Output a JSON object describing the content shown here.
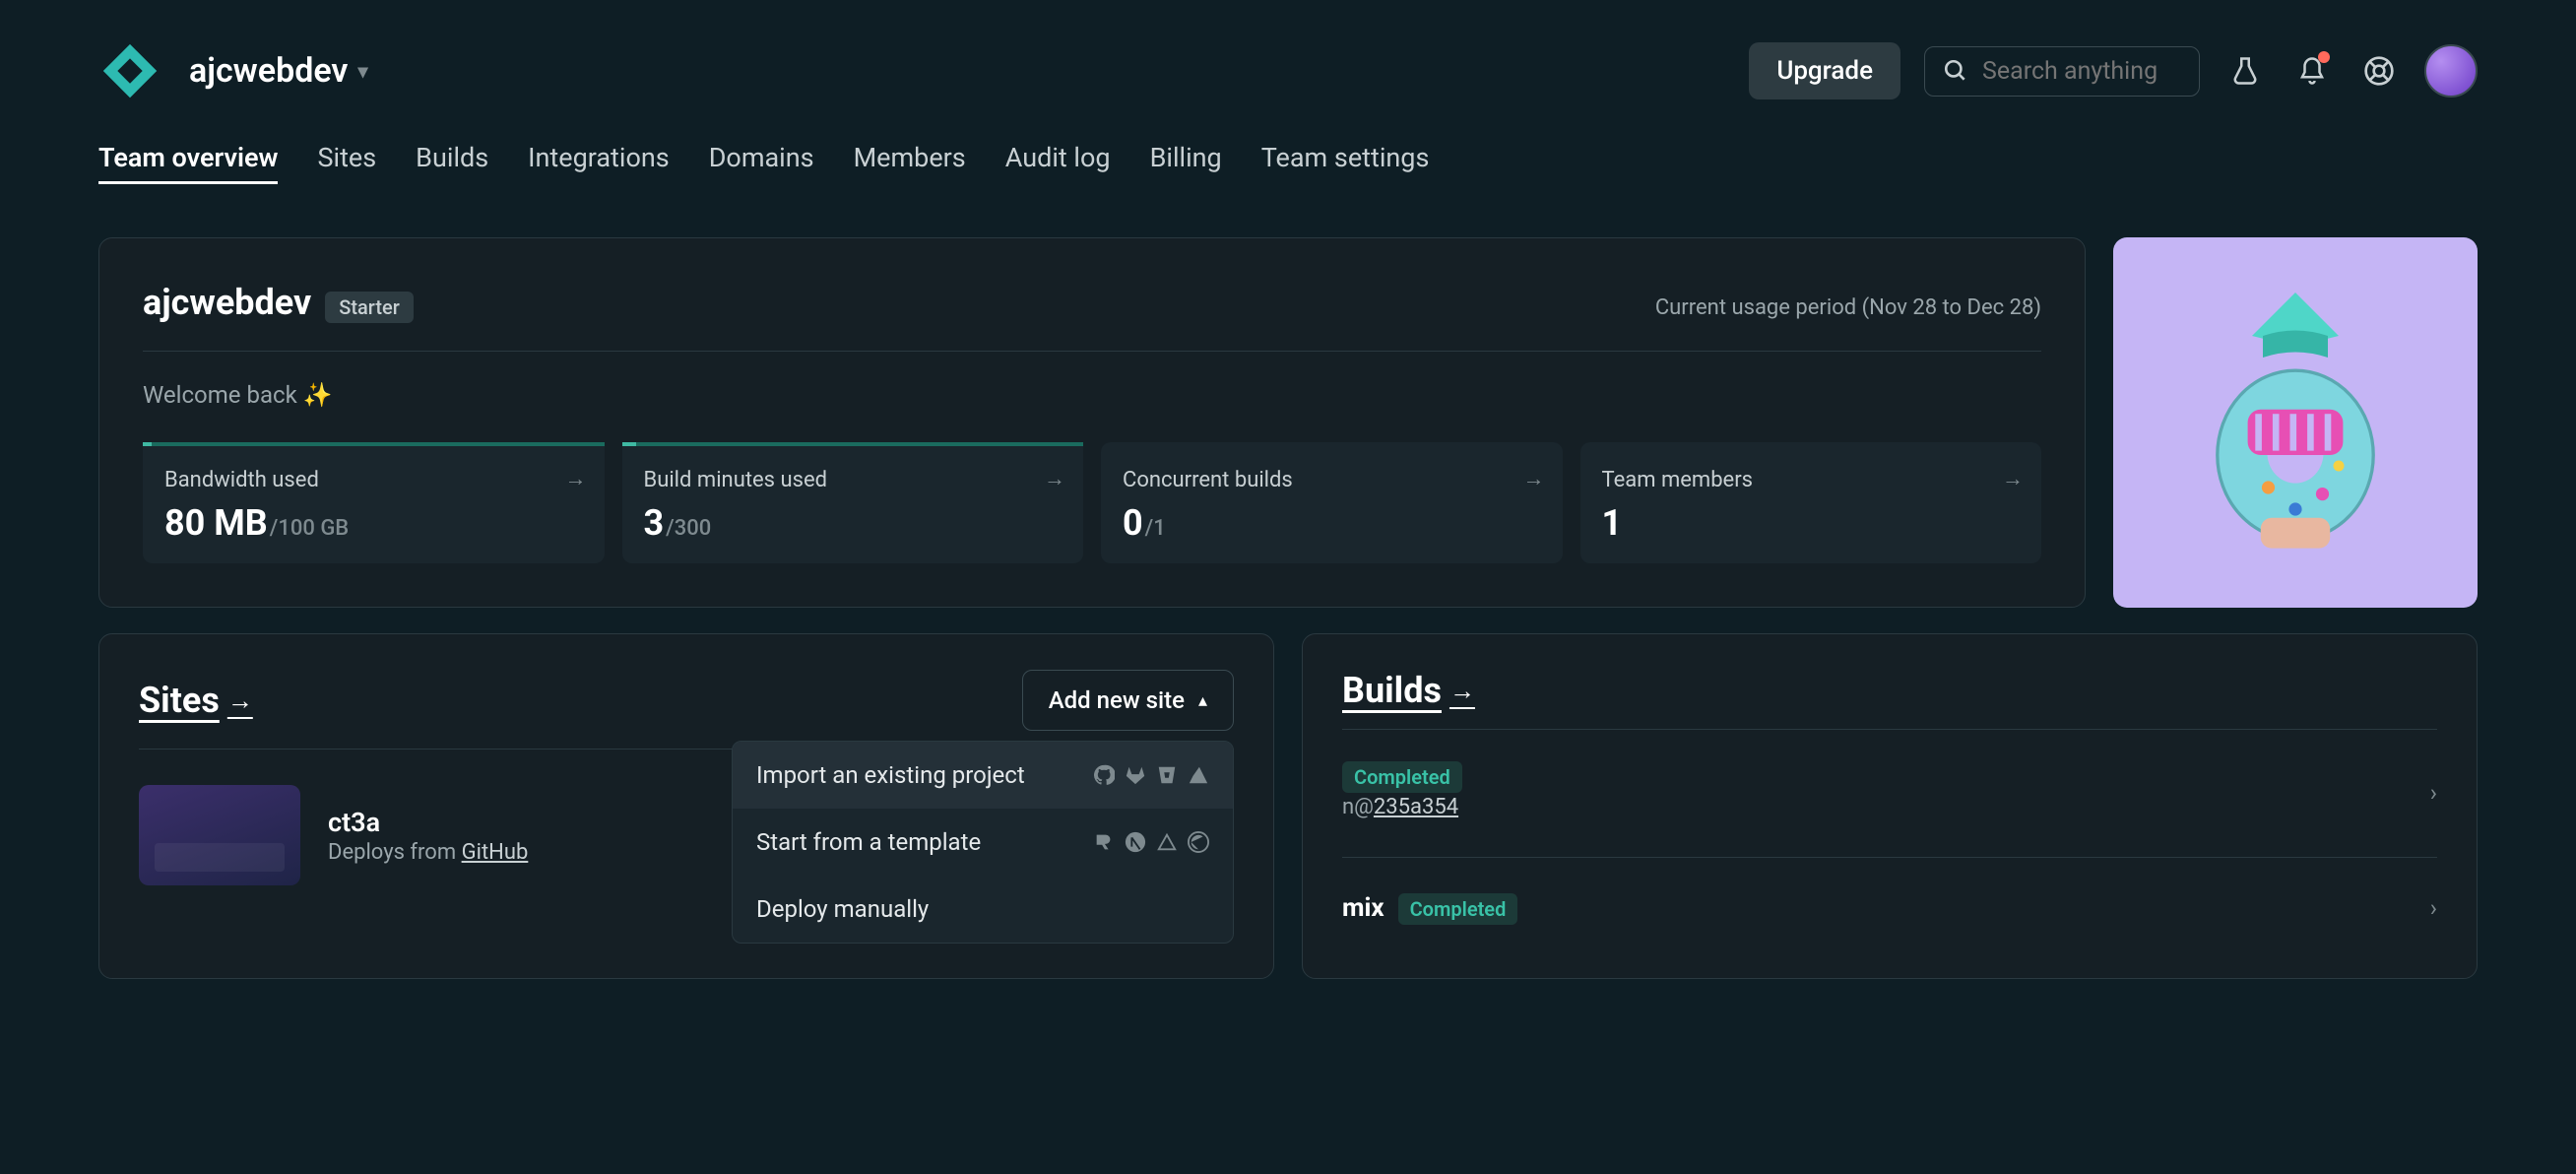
{
  "header": {
    "team_name": "ajcwebdev",
    "upgrade_label": "Upgrade",
    "search_placeholder": "Search anything"
  },
  "nav": {
    "tabs": [
      "Team overview",
      "Sites",
      "Builds",
      "Integrations",
      "Domains",
      "Members",
      "Audit log",
      "Billing",
      "Team settings"
    ],
    "active_index": 0
  },
  "overview": {
    "team_name": "ajcwebdev",
    "plan": "Starter",
    "usage_period": "Current usage period (Nov 28 to Dec 28)",
    "welcome": "Welcome back ✨",
    "stats": [
      {
        "label": "Bandwidth used",
        "value": "80 MB",
        "sub": "/100 GB"
      },
      {
        "label": "Build minutes used",
        "value": "3",
        "sub": "/300"
      },
      {
        "label": "Concurrent builds",
        "value": "0",
        "sub": "/1"
      },
      {
        "label": "Team members",
        "value": "1",
        "sub": ""
      }
    ]
  },
  "sites_panel": {
    "title": "Sites",
    "add_label": "Add new site",
    "dropdown": [
      "Import an existing project",
      "Start from a template",
      "Deploy manually"
    ],
    "items": [
      {
        "name": "ct3a",
        "deploys_prefix": "Deploys from ",
        "deploys_source": "GitHub"
      }
    ]
  },
  "builds_panel": {
    "title": "Builds",
    "badge_label": "Completed",
    "items": [
      {
        "name_hidden": true,
        "status": "Completed",
        "branch_prefix": "n@",
        "hash": "235a354"
      },
      {
        "name": "mix",
        "status": "Completed"
      }
    ]
  }
}
